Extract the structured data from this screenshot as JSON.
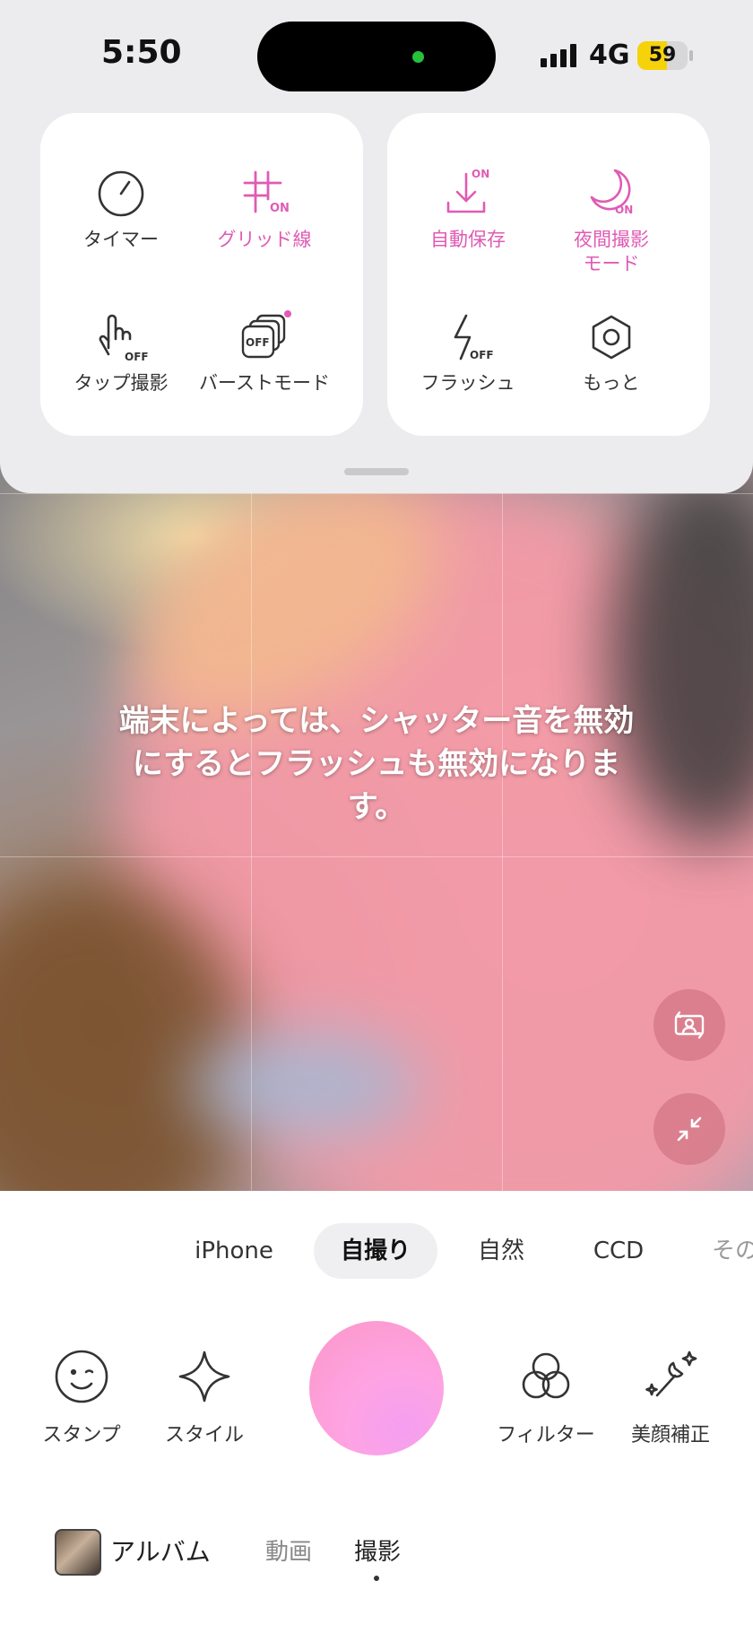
{
  "status_bar": {
    "time": "5:50",
    "network": "4G",
    "battery": "59",
    "battery_level": 0.59
  },
  "settings": {
    "left_card": [
      {
        "id": "timer",
        "label": "タイマー",
        "icon": "timer-icon",
        "active": false
      },
      {
        "id": "grid",
        "label": "グリッド線",
        "icon": "grid-on-icon",
        "badge": "ON",
        "active": true
      },
      {
        "id": "tap-shoot",
        "label": "タップ撮影",
        "icon": "tap-off-icon",
        "badge": "OFF",
        "active": false
      },
      {
        "id": "burst",
        "label": "バーストモード",
        "icon": "burst-off-icon",
        "badge": "OFF",
        "active": false
      }
    ],
    "right_card": [
      {
        "id": "autosave",
        "label": "自動保存",
        "icon": "download-on-icon",
        "badge": "ON",
        "active": true
      },
      {
        "id": "night",
        "label": "夜間撮影\nモード",
        "icon": "moon-on-icon",
        "badge": "ON",
        "active": true
      },
      {
        "id": "flash",
        "label": "フラッシュ",
        "icon": "flash-off-icon",
        "badge": "OFF",
        "active": false
      },
      {
        "id": "more",
        "label": "もっと",
        "icon": "hexagon-icon",
        "active": false
      }
    ]
  },
  "notice": "端末によっては、シャッター音を無効にするとフラッシュも無効になります。",
  "style_tabs": [
    "iPhone",
    "自撮り",
    "自然",
    "CCD",
    "その"
  ],
  "active_style": "自撮り",
  "tools": {
    "stamp": "スタンプ",
    "style": "スタイル",
    "filter": "フィルター",
    "beauty": "美顔補正"
  },
  "bottom_nav": {
    "album": "アルバム",
    "video": "動画",
    "photo": "撮影",
    "active": "撮影"
  },
  "colors": {
    "accent_pink": "#e05bb4",
    "shutter": "#fba3e3",
    "active_tab_bg": "#efeff1"
  }
}
